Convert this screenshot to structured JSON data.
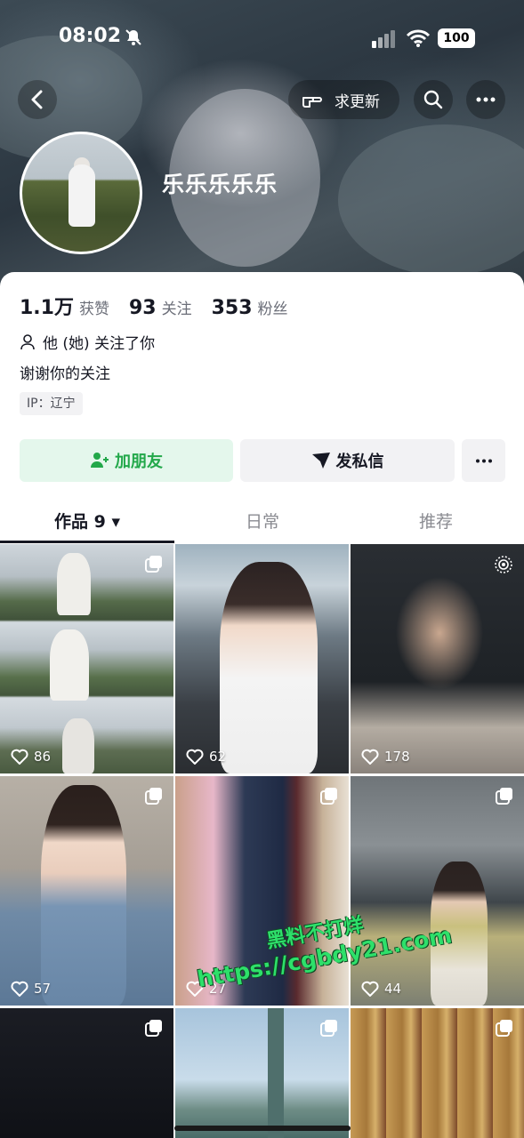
{
  "status_bar": {
    "time": "08:02",
    "battery": "100"
  },
  "header": {
    "request_update_label": "求更新",
    "nickname": "乐乐乐乐乐"
  },
  "profile": {
    "stats": [
      {
        "num": "1.1万",
        "label": "获赞"
      },
      {
        "num": "93",
        "label": "关注"
      },
      {
        "num": "353",
        "label": "粉丝"
      }
    ],
    "follow_status": "他 (她) 关注了你",
    "bio": "谢谢你的关注",
    "ip": "IP：辽宁"
  },
  "actions": {
    "add_friend": "加朋友",
    "send_message": "发私信"
  },
  "tabs": [
    {
      "label": "作品 9 ▾",
      "active": true
    },
    {
      "label": "日常",
      "active": false
    },
    {
      "label": "推荐",
      "active": false
    }
  ],
  "posts": [
    {
      "likes": "86",
      "badge": "multi-image-icon"
    },
    {
      "likes": "62",
      "badge": ""
    },
    {
      "likes": "178",
      "badge": "live-photo-icon"
    },
    {
      "likes": "57",
      "badge": "multi-image-icon"
    },
    {
      "likes": "27",
      "badge": "multi-image-icon"
    },
    {
      "likes": "44",
      "badge": "multi-image-icon"
    },
    {
      "likes": "",
      "badge": "multi-image-icon"
    },
    {
      "likes": "",
      "badge": "multi-image-icon"
    },
    {
      "likes": "",
      "badge": "multi-image-icon"
    }
  ],
  "watermark": {
    "line1": "黑料不打烊",
    "line2": "https://cgbdy21.com"
  },
  "colors": {
    "accent_green": "#22a84a",
    "add_friend_bg": "#e4f7ec",
    "watermark_green": "#2ee06a"
  }
}
